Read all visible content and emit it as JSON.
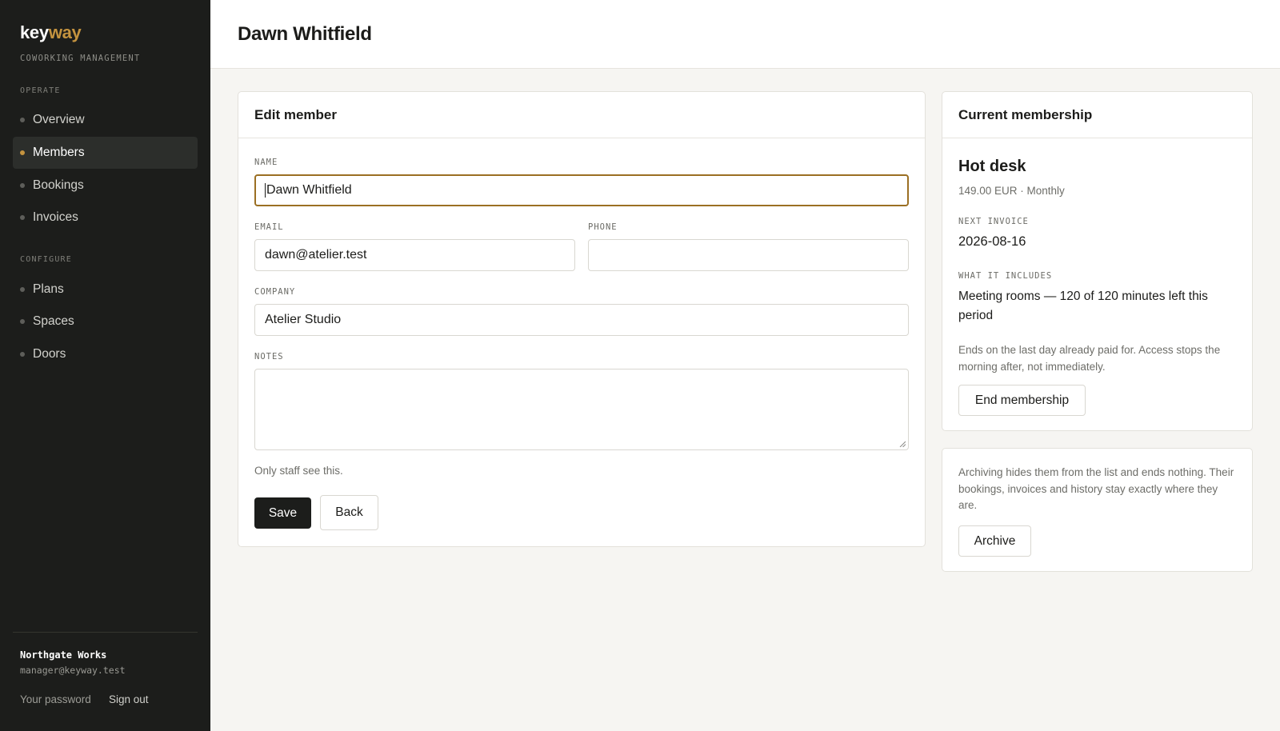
{
  "brand": {
    "part1": "key",
    "part2": "way",
    "tagline": "COWORKING MANAGEMENT",
    "accent_color": "#c4933f"
  },
  "nav": {
    "sections": [
      {
        "title": "OPERATE",
        "items": [
          {
            "label": "Overview",
            "active": false
          },
          {
            "label": "Members",
            "active": true
          },
          {
            "label": "Bookings",
            "active": false
          },
          {
            "label": "Invoices",
            "active": false
          }
        ]
      },
      {
        "title": "CONFIGURE",
        "items": [
          {
            "label": "Plans",
            "active": false
          },
          {
            "label": "Spaces",
            "active": false
          },
          {
            "label": "Doors",
            "active": false
          }
        ]
      }
    ]
  },
  "account": {
    "org_name": "Northgate Works",
    "email": "manager@keyway.test",
    "password_link": "Your password",
    "signout_link": "Sign out"
  },
  "header": {
    "title": "Dawn Whitfield"
  },
  "edit_form": {
    "title": "Edit member",
    "name": {
      "label": "NAME",
      "value": "Dawn Whitfield"
    },
    "email": {
      "label": "EMAIL",
      "value": "dawn@atelier.test"
    },
    "phone": {
      "label": "PHONE",
      "value": ""
    },
    "company": {
      "label": "COMPANY",
      "value": "Atelier Studio"
    },
    "notes": {
      "label": "NOTES",
      "value": "",
      "hint": "Only staff see this."
    },
    "save_label": "Save",
    "back_label": "Back"
  },
  "membership": {
    "title": "Current membership",
    "plan_name": "Hot desk",
    "price": "149.00 EUR · Monthly",
    "next_invoice_label": "NEXT INVOICE",
    "next_invoice_date": "2026-08-16",
    "includes_label": "WHAT IT INCLUDES",
    "includes_text": "Meeting rooms — 120 of 120 minutes left this period",
    "end_note": "Ends on the last day already paid for. Access stops the morning after, not immediately.",
    "end_button": "End membership"
  },
  "archive": {
    "note": "Archiving hides them from the list and ends nothing. Their bookings, invoices and history stay exactly where they are.",
    "button": "Archive"
  }
}
